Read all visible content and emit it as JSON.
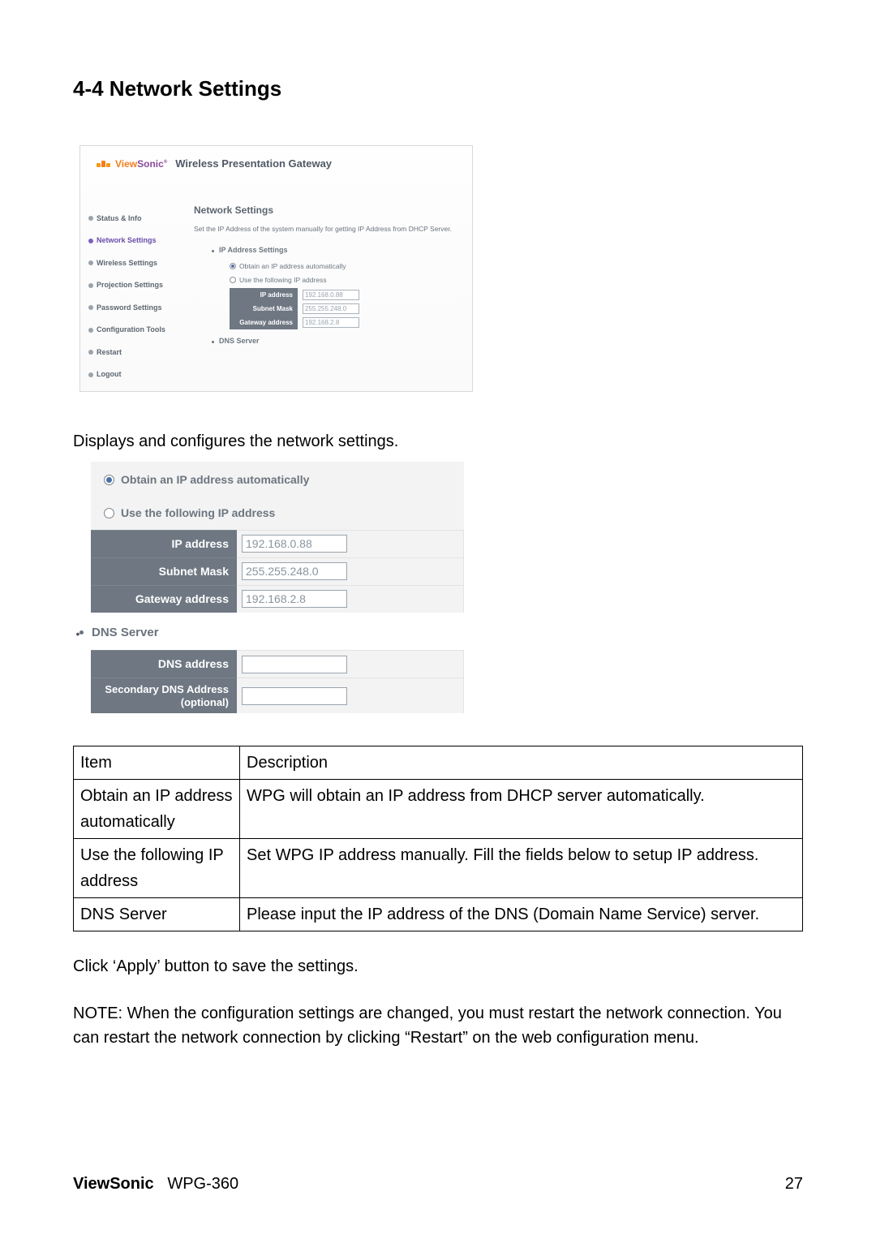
{
  "section_title": "4-4 Network Settings",
  "shot1": {
    "brand_vs": "ViewSonic",
    "brand_prod": "Wireless Presentation Gateway",
    "nav": [
      {
        "label": "Status & Info",
        "active": false
      },
      {
        "label": "Network Settings",
        "active": true
      },
      {
        "label": "Wireless Settings",
        "active": false
      },
      {
        "label": "Projection Settings",
        "active": false
      },
      {
        "label": "Password Settings",
        "active": false
      },
      {
        "label": "Configuration Tools",
        "active": false
      },
      {
        "label": "Restart",
        "active": false
      },
      {
        "label": "Logout",
        "active": false
      }
    ],
    "heading": "Network Settings",
    "sub": "Set the IP Address of the system manually for getting IP Address from DHCP Server.",
    "bullet1": "IP Address Settings",
    "radio1": "Obtain an IP address automatically",
    "radio2": "Use the following IP address",
    "rows": [
      {
        "label": "IP address",
        "value": "192.168.0.88"
      },
      {
        "label": "Subnet Mask",
        "value": "255.255.248.0"
      },
      {
        "label": "Gateway address",
        "value": "192.168.2.8"
      }
    ],
    "bullet2": "DNS Server"
  },
  "caption1": "Displays and configures the network settings.",
  "shot2": {
    "radio1": "Obtain an IP address automatically",
    "radio2": "Use the following IP address",
    "rows": [
      {
        "label": "IP address",
        "value": "192.168.0.88"
      },
      {
        "label": "Subnet Mask",
        "value": "255.255.248.0"
      },
      {
        "label": "Gateway address",
        "value": "192.168.2.8"
      }
    ],
    "dns_header": "DNS Server",
    "dns_rows": [
      {
        "label": "DNS address",
        "value": ""
      },
      {
        "label": "Secondary DNS Address (optional)",
        "value": ""
      }
    ]
  },
  "table": {
    "h1": "Item",
    "h2": "Description",
    "rows": [
      {
        "item": "Obtain an IP address automatically",
        "desc": "WPG will obtain an IP address from DHCP server automatically."
      },
      {
        "item": "Use the following IP address",
        "desc": "Set WPG IP address manually. Fill the fields below to setup IP address."
      },
      {
        "item": "DNS Server",
        "desc": "Please input the IP address of the DNS (Domain Name Service) server."
      }
    ]
  },
  "para_apply": "Click ‘Apply’ button to save the settings.",
  "para_note": "NOTE: When the configuration settings are changed, you must restart the network connection. You can restart the network connection by clicking “Restart” on the web configuration menu.",
  "footer": {
    "brand": "ViewSonic",
    "model": "WPG-360",
    "page": "27"
  }
}
